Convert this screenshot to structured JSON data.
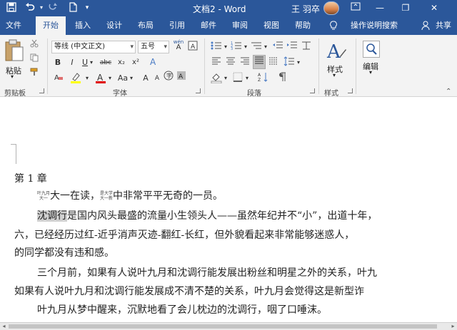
{
  "window": {
    "title": "文档2 - Word",
    "user_name": "王 羽卒",
    "minimize_glyph": "—",
    "restore_glyph": "❐",
    "close_glyph": "✕"
  },
  "quick_access": {
    "save_icon": "save-icon",
    "undo_icon": "undo-icon",
    "redo_icon": "redo-icon",
    "new_icon": "new-document-icon",
    "customize_icon": "chevron-down-icon"
  },
  "tabs": [
    "文件",
    "开始",
    "插入",
    "设计",
    "布局",
    "引用",
    "邮件",
    "审阅",
    "视图",
    "帮助",
    "操作说明搜索",
    "共享"
  ],
  "active_tab": "开始",
  "ribbon": {
    "clipboard": {
      "paste_label": "粘贴",
      "group_label": "剪贴板"
    },
    "font": {
      "font_name": "等线 (中文正文)",
      "font_size": "五号",
      "wen_label": "wén",
      "A_label": "A",
      "bold": "B",
      "italic": "I",
      "underline": "U",
      "strike": "abc",
      "subscript": "x₂",
      "superscript": "x²",
      "aa": "Aa",
      "group_label": "字体",
      "highlight_color": "#ffff00",
      "font_color": "#e00000"
    },
    "paragraph": {
      "group_label": "段落"
    },
    "styles": {
      "label": "样式",
      "group_label": "样式"
    },
    "editing": {
      "label": "编辑"
    }
  },
  "document": {
    "chapter": "第 1 章",
    "line1_ruby1_top": "叶九月",
    "line1_ruby1_bottom": "大一",
    "line1_part1": "大一在读，",
    "line1_ruby2_top": "是大学",
    "line1_ruby2_bottom": "大一新",
    "line1_part2": "中非常平平无奇的一员。",
    "line2_highlight": "沈调行",
    "line2_rest": "是国内风头最盛的流量小生领头人——虽然年纪并不“小”，出道十年，",
    "line3": "六，已经经历过红-近乎消声灭迹-翻红-长红，但外貌看起来非常能够迷惑人，",
    "line4": "的同学都没有违和感。",
    "line5": "三个月前，如果有人说叶九月和沈调行能发展出粉丝和明星之外的关系，叶九",
    "line6": "如果有人说叶九月和沈调行能发展成不清不楚的关系，叶九月会觉得这是新型诈",
    "line7": "叶九月从梦中醒来，沉默地看了会儿枕边的沈调行，咽了口唾沫。"
  }
}
